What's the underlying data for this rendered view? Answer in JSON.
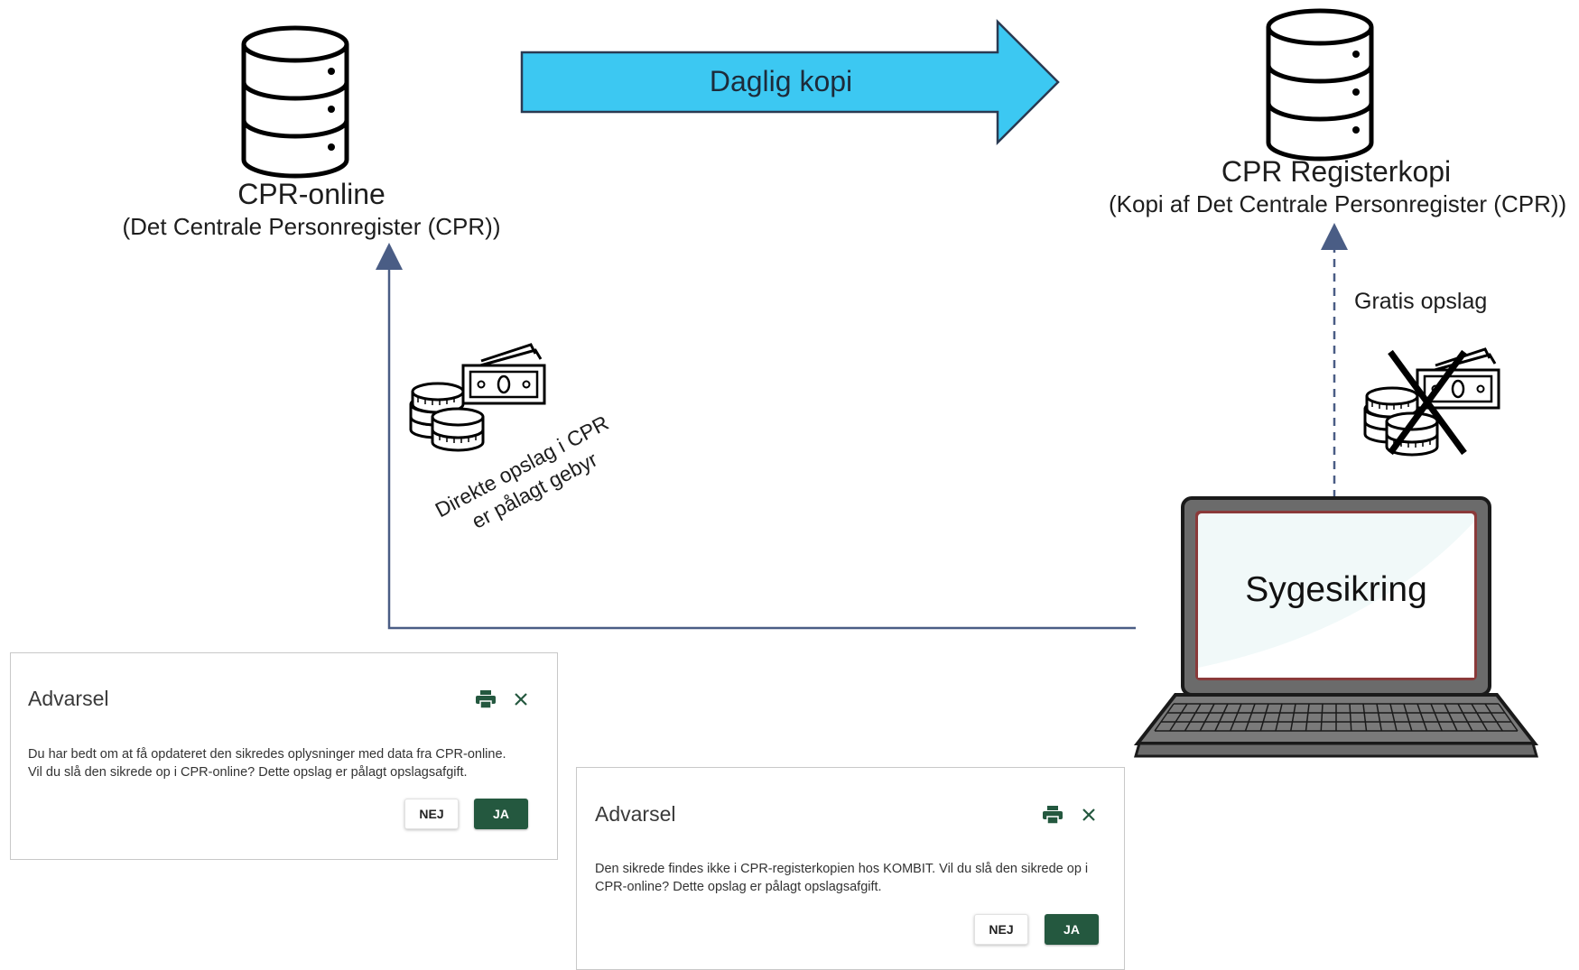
{
  "diagram": {
    "arrow_label": "Daglig kopi",
    "source": {
      "title": "CPR-online",
      "subtitle": "(Det Centrale Personregister (CPR))"
    },
    "target": {
      "title": "CPR Registerkopi",
      "subtitle": "(Kopi af Det Centrale Personregister (CPR))"
    },
    "free_lookup_label": "Gratis opslag",
    "paid_lookup_label_line1": "Direkte opslag i CPR",
    "paid_lookup_label_line2": "er pålagt gebyr",
    "client_label": "Sygesikring"
  },
  "dialogs": [
    {
      "title": "Advarsel",
      "text_line1": "Du har bedt om at få opdateret den sikredes oplysninger med data fra CPR-online.",
      "text_line2": "Vil du slå den sikrede op i CPR-online? Dette opslag er pålagt opslagsafgift.",
      "no_label": "NEJ",
      "yes_label": "JA"
    },
    {
      "title": "Advarsel",
      "text_line1": "Den sikrede findes ikke i CPR-registerkopien hos KOMBIT. Vil du slå den sikrede op i",
      "text_line2": "CPR-online? Dette opslag er pålagt opslagsafgift.",
      "no_label": "NEJ",
      "yes_label": "JA"
    }
  ],
  "colors": {
    "arrow_fill": "#3cc8f2",
    "connector": "#4a5d85",
    "accent_green": "#24583f"
  },
  "icons": [
    "database-icon",
    "money-icon",
    "crossed-money-icon",
    "laptop-icon",
    "print-icon",
    "close-icon"
  ]
}
